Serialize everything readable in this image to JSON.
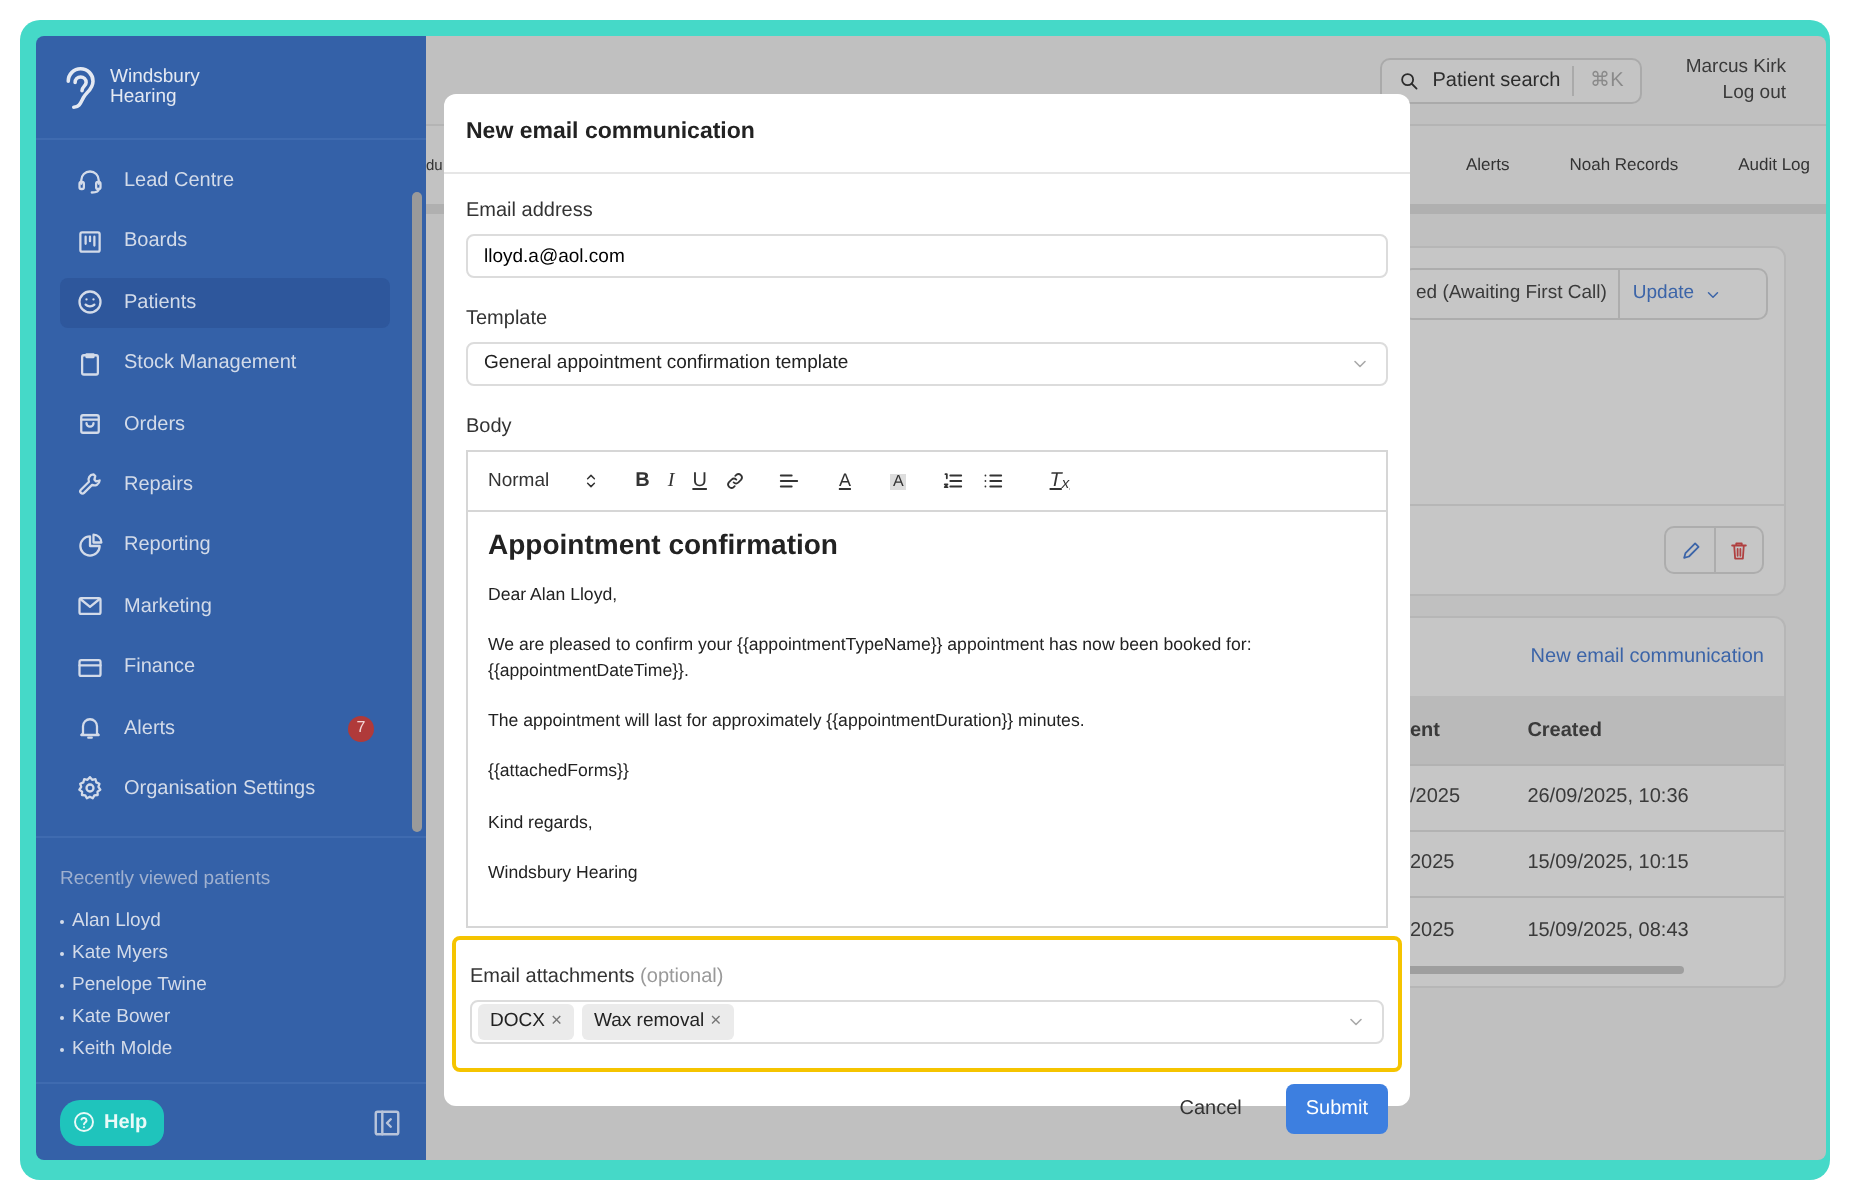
{
  "sidebar": {
    "logo": {
      "line_1": "Windsbury",
      "line_2": "Hearing"
    },
    "items": [
      {
        "label": "Lead Centre",
        "selected": false
      },
      {
        "label": "Boards",
        "selected": false
      },
      {
        "label": "Patients",
        "selected": true
      },
      {
        "label": "Stock Management",
        "selected": false
      },
      {
        "label": "Orders",
        "selected": false
      },
      {
        "label": "Repairs",
        "selected": false
      },
      {
        "label": "Reporting",
        "selected": false
      },
      {
        "label": "Marketing",
        "selected": false
      },
      {
        "label": "Finance",
        "selected": false
      },
      {
        "label": "Alerts",
        "selected": false,
        "badge": "7"
      },
      {
        "label": "Organisation Settings",
        "selected": false
      }
    ],
    "recent": {
      "title": "Recently viewed patients",
      "patients": [
        "Alan Lloyd",
        "Kate Myers",
        "Penelope Twine",
        "Kate Bower",
        "Keith Molde"
      ]
    },
    "help_button": "Help"
  },
  "header": {
    "search": {
      "label": "Patient search",
      "shortcut": "⌘K"
    },
    "user": "Marcus Kirk",
    "logout": "Log out"
  },
  "tabs": [
    {
      "label": "du"
    },
    {
      "label": "Alerts"
    },
    {
      "label": "Noah Records"
    },
    {
      "label": "Audit Log"
    }
  ],
  "status_card": {
    "status": "ed (Awaiting First Call)",
    "update_button": "Update"
  },
  "communications": {
    "link": "New email communication",
    "columns": [
      "ent",
      "Created"
    ],
    "rows": [
      [
        "/2025",
        "26/09/2025, 10:36"
      ],
      [
        "2025",
        "15/09/2025, 10:15"
      ],
      [
        "2025",
        "15/09/2025, 08:43"
      ]
    ]
  },
  "modal": {
    "title": "New email communication",
    "email": {
      "label": "Email address",
      "value": "lloyd.a@aol.com"
    },
    "template": {
      "label": "Template",
      "value": "General appointment confirmation template"
    },
    "body": {
      "label": "Body",
      "format": "Normal",
      "toolbar": [
        {
          "kind": "bold",
          "label": "B"
        },
        {
          "kind": "italic",
          "label": "I"
        },
        {
          "kind": "underline",
          "label": "U"
        },
        {
          "kind": "link"
        },
        {
          "kind": "align"
        },
        {
          "kind": "color",
          "label": "A"
        },
        {
          "kind": "background",
          "label": "A"
        },
        {
          "kind": "ordered-list"
        },
        {
          "kind": "bullet-list"
        },
        {
          "kind": "clean",
          "label": "T$_{x}$"
        }
      ],
      "heading": "Appointment confirmation",
      "paragraphs": [
        "Dear Alan Lloyd,",
        "We are pleased to confirm your {{appointmentTypeName}} appointment has now been booked for: {{appointmentDateTime}}.",
        "The appointment will last for approximately {{appointmentDuration}} minutes.",
        "{{attachedForms}}",
        "Kind regards,",
        "Windsbury Hearing"
      ]
    },
    "attachments": {
      "label": "Email attachments",
      "hint": "(optional)",
      "highlighted": true,
      "tags": [
        {
          "label": "DOCX",
          "remove": "×"
        },
        {
          "label": "Wax removal",
          "remove": "×"
        }
      ]
    },
    "cancel": "Cancel",
    "submit": "Submit"
  }
}
